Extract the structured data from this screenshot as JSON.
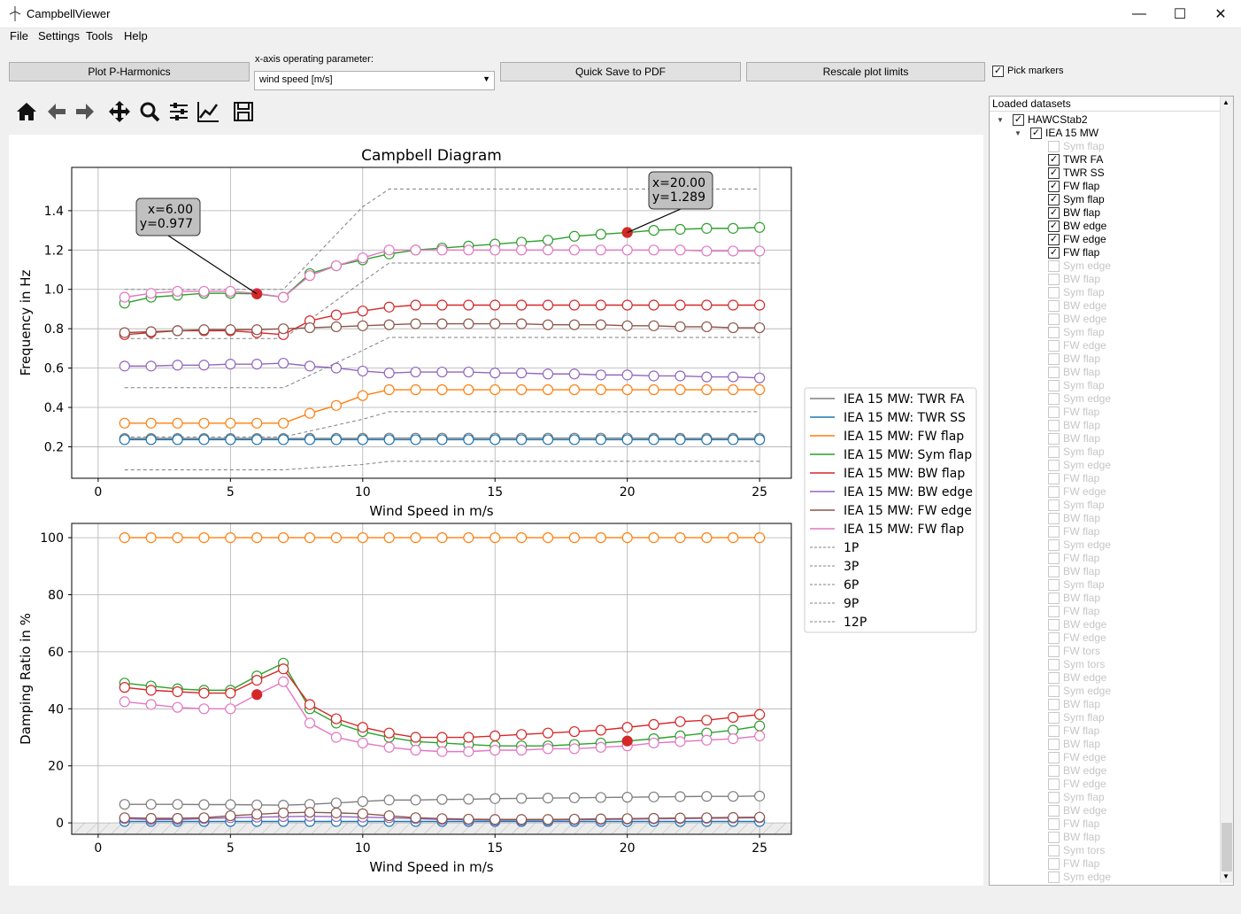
{
  "app": {
    "title": "CampbellViewer"
  },
  "menu": [
    "File",
    "Settings",
    "Tools",
    "Help"
  ],
  "controls": {
    "plot_p_harmonics": "Plot P-Harmonics",
    "x_axis_label": "x-axis operating parameter:",
    "x_axis_value": "wind speed [m/s]",
    "quick_save": "Quick Save to PDF",
    "rescale": "Rescale plot limits",
    "pick_markers": "Pick markers",
    "pick_markers_checked": true
  },
  "toolbar_icons": [
    "home-icon",
    "back-arrow-icon",
    "forward-arrow-icon",
    "pan-icon",
    "zoom-icon",
    "configure-subplots-icon",
    "edit-axis-icon",
    "save-icon"
  ],
  "tree": {
    "header": "Loaded datasets",
    "root": "HAWCStab2",
    "child": "IEA 15 MW",
    "modes": [
      {
        "name": "Sym flap",
        "on": false,
        "checked": false
      },
      {
        "name": "TWR FA",
        "on": true,
        "checked": true
      },
      {
        "name": "TWR SS",
        "on": true,
        "checked": true
      },
      {
        "name": "FW flap",
        "on": true,
        "checked": true
      },
      {
        "name": "Sym flap",
        "on": true,
        "checked": true
      },
      {
        "name": "BW flap",
        "on": true,
        "checked": true
      },
      {
        "name": "BW edge",
        "on": true,
        "checked": true
      },
      {
        "name": "FW edge",
        "on": true,
        "checked": true
      },
      {
        "name": "FW flap",
        "on": true,
        "checked": true
      },
      {
        "name": "Sym edge",
        "on": false,
        "checked": false
      },
      {
        "name": "BW flap",
        "on": false,
        "checked": false
      },
      {
        "name": "Sym flap",
        "on": false,
        "checked": false
      },
      {
        "name": "BW edge",
        "on": false,
        "checked": false
      },
      {
        "name": "BW edge",
        "on": false,
        "checked": false
      },
      {
        "name": "Sym flap",
        "on": false,
        "checked": false
      },
      {
        "name": "FW edge",
        "on": false,
        "checked": false
      },
      {
        "name": "BW flap",
        "on": false,
        "checked": false
      },
      {
        "name": "BW flap",
        "on": false,
        "checked": false
      },
      {
        "name": "Sym flap",
        "on": false,
        "checked": false
      },
      {
        "name": "Sym edge",
        "on": false,
        "checked": false
      },
      {
        "name": "FW flap",
        "on": false,
        "checked": false
      },
      {
        "name": "BW flap",
        "on": false,
        "checked": false
      },
      {
        "name": "BW flap",
        "on": false,
        "checked": false
      },
      {
        "name": "Sym flap",
        "on": false,
        "checked": false
      },
      {
        "name": "Sym edge",
        "on": false,
        "checked": false
      },
      {
        "name": "FW flap",
        "on": false,
        "checked": false
      },
      {
        "name": "FW edge",
        "on": false,
        "checked": false
      },
      {
        "name": "Sym flap",
        "on": false,
        "checked": false
      },
      {
        "name": "BW flap",
        "on": false,
        "checked": false
      },
      {
        "name": "FW flap",
        "on": false,
        "checked": false
      },
      {
        "name": "Sym edge",
        "on": false,
        "checked": false
      },
      {
        "name": "FW flap",
        "on": false,
        "checked": false
      },
      {
        "name": "BW flap",
        "on": false,
        "checked": false
      },
      {
        "name": "Sym flap",
        "on": false,
        "checked": false
      },
      {
        "name": "BW flap",
        "on": false,
        "checked": false
      },
      {
        "name": "FW flap",
        "on": false,
        "checked": false
      },
      {
        "name": "BW edge",
        "on": false,
        "checked": false
      },
      {
        "name": "FW edge",
        "on": false,
        "checked": false
      },
      {
        "name": "FW tors",
        "on": false,
        "checked": false
      },
      {
        "name": "Sym tors",
        "on": false,
        "checked": false
      },
      {
        "name": "BW edge",
        "on": false,
        "checked": false
      },
      {
        "name": "Sym edge",
        "on": false,
        "checked": false
      },
      {
        "name": "BW flap",
        "on": false,
        "checked": false
      },
      {
        "name": "Sym flap",
        "on": false,
        "checked": false
      },
      {
        "name": "FW flap",
        "on": false,
        "checked": false
      },
      {
        "name": "BW flap",
        "on": false,
        "checked": false
      },
      {
        "name": "FW edge",
        "on": false,
        "checked": false
      },
      {
        "name": "BW edge",
        "on": false,
        "checked": false
      },
      {
        "name": "FW edge",
        "on": false,
        "checked": false
      },
      {
        "name": "Sym flap",
        "on": false,
        "checked": false
      },
      {
        "name": "BW edge",
        "on": false,
        "checked": false
      },
      {
        "name": "FW flap",
        "on": false,
        "checked": false
      },
      {
        "name": "BW flap",
        "on": false,
        "checked": false
      },
      {
        "name": "Sym tors",
        "on": false,
        "checked": false
      },
      {
        "name": "FW flap",
        "on": false,
        "checked": false
      },
      {
        "name": "Sym edge",
        "on": false,
        "checked": false
      }
    ]
  },
  "chart_data": [
    {
      "type": "line",
      "title": "Campbell Diagram",
      "xlabel": "Wind Speed in m/s",
      "ylabel": "Frequency in Hz",
      "xlim": [
        -1,
        26.2
      ],
      "ylim": [
        0.04,
        1.62
      ],
      "xticks": [
        0,
        5,
        10,
        15,
        20,
        25
      ],
      "yticks": [
        0.2,
        0.4,
        0.6,
        0.8,
        1.0,
        1.2,
        1.4
      ],
      "x": [
        1,
        2,
        3,
        4,
        5,
        6,
        7,
        8,
        9,
        10,
        11,
        12,
        13,
        14,
        15,
        16,
        17,
        18,
        19,
        20,
        21,
        22,
        23,
        24,
        25
      ],
      "series": [
        {
          "name": "IEA 15 MW: TWR FA",
          "color": "#7f7f7f",
          "values": [
            0.242,
            0.242,
            0.242,
            0.242,
            0.242,
            0.242,
            0.242,
            0.243,
            0.243,
            0.243,
            0.244,
            0.244,
            0.244,
            0.244,
            0.244,
            0.244,
            0.244,
            0.244,
            0.244,
            0.244,
            0.243,
            0.243,
            0.243,
            0.243,
            0.243
          ]
        },
        {
          "name": "IEA 15 MW: TWR SS",
          "color": "#1f77b4",
          "values": [
            0.236,
            0.236,
            0.236,
            0.236,
            0.236,
            0.236,
            0.236,
            0.236,
            0.236,
            0.236,
            0.236,
            0.236,
            0.236,
            0.236,
            0.236,
            0.236,
            0.236,
            0.236,
            0.236,
            0.236,
            0.236,
            0.236,
            0.236,
            0.236,
            0.236
          ]
        },
        {
          "name": "IEA 15 MW: FW flap",
          "color": "#ff7f0e",
          "values": [
            0.32,
            0.32,
            0.32,
            0.32,
            0.32,
            0.32,
            0.32,
            0.37,
            0.41,
            0.46,
            0.49,
            0.49,
            0.49,
            0.49,
            0.49,
            0.49,
            0.49,
            0.49,
            0.49,
            0.49,
            0.49,
            0.49,
            0.49,
            0.49,
            0.49
          ]
        },
        {
          "name": "IEA 15 MW: Sym flap",
          "color": "#2ca02c",
          "values": [
            0.93,
            0.96,
            0.97,
            0.98,
            0.98,
            0.977,
            0.96,
            1.08,
            1.12,
            1.15,
            1.18,
            1.2,
            1.21,
            1.22,
            1.23,
            1.24,
            1.25,
            1.27,
            1.28,
            1.289,
            1.3,
            1.305,
            1.31,
            1.31,
            1.315
          ]
        },
        {
          "name": "IEA 15 MW: BW flap",
          "color": "#d62728",
          "values": [
            0.77,
            0.78,
            0.79,
            0.79,
            0.79,
            0.78,
            0.77,
            0.84,
            0.87,
            0.89,
            0.91,
            0.92,
            0.92,
            0.92,
            0.92,
            0.92,
            0.92,
            0.92,
            0.92,
            0.92,
            0.92,
            0.92,
            0.92,
            0.92,
            0.92
          ]
        },
        {
          "name": "IEA 15 MW: BW edge",
          "color": "#9467bd",
          "values": [
            0.61,
            0.61,
            0.615,
            0.615,
            0.62,
            0.62,
            0.625,
            0.61,
            0.6,
            0.585,
            0.575,
            0.58,
            0.58,
            0.58,
            0.575,
            0.575,
            0.57,
            0.57,
            0.565,
            0.565,
            0.56,
            0.56,
            0.555,
            0.555,
            0.55
          ]
        },
        {
          "name": "IEA 15 MW: FW edge",
          "color": "#8c564b",
          "values": [
            0.78,
            0.785,
            0.79,
            0.795,
            0.795,
            0.795,
            0.8,
            0.805,
            0.81,
            0.815,
            0.82,
            0.825,
            0.825,
            0.825,
            0.825,
            0.825,
            0.82,
            0.82,
            0.82,
            0.815,
            0.815,
            0.81,
            0.81,
            0.805,
            0.805
          ]
        },
        {
          "name": "IEA 15 MW: FW flap",
          "color": "#e377c2",
          "values": [
            0.96,
            0.98,
            0.99,
            0.99,
            0.99,
            0.98,
            0.96,
            1.07,
            1.12,
            1.16,
            1.2,
            1.2,
            1.2,
            1.2,
            1.2,
            1.2,
            1.2,
            1.2,
            1.2,
            1.2,
            1.2,
            1.2,
            1.195,
            1.195,
            1.195
          ]
        }
      ],
      "harmonics": [
        {
          "name": "1P",
          "x": [
            1,
            7,
            10,
            11,
            25
          ],
          "values": [
            0.083,
            0.083,
            0.11,
            0.126,
            0.126
          ]
        },
        {
          "name": "3P",
          "x": [
            1,
            7,
            10,
            11,
            25
          ],
          "values": [
            0.25,
            0.25,
            0.34,
            0.378,
            0.378
          ]
        },
        {
          "name": "6P",
          "x": [
            1,
            7,
            10,
            11,
            25
          ],
          "values": [
            0.5,
            0.5,
            0.69,
            0.756,
            0.756
          ]
        },
        {
          "name": "9P",
          "x": [
            1,
            7,
            10,
            11,
            25
          ],
          "values": [
            0.75,
            0.75,
            1.04,
            1.134,
            1.134
          ]
        },
        {
          "name": "12P",
          "x": [
            1,
            7,
            10,
            11,
            25
          ],
          "values": [
            1.0,
            1.0,
            1.42,
            1.51,
            1.51
          ]
        }
      ],
      "annotations": [
        {
          "text": "x=6.00\ny=0.977",
          "x": 6,
          "y": 0.977
        },
        {
          "text": "x=20.00\ny=1.289",
          "x": 20,
          "y": 1.289
        }
      ]
    },
    {
      "type": "line",
      "title": "",
      "xlabel": "Wind Speed in m/s",
      "ylabel": "Damping Ratio in %",
      "xlim": [
        -1,
        26.2
      ],
      "ylim": [
        -4,
        105
      ],
      "xticks": [
        0,
        5,
        10,
        15,
        20,
        25
      ],
      "yticks": [
        0,
        20,
        40,
        60,
        80,
        100
      ],
      "x": [
        1,
        2,
        3,
        4,
        5,
        6,
        7,
        8,
        9,
        10,
        11,
        12,
        13,
        14,
        15,
        16,
        17,
        18,
        19,
        20,
        21,
        22,
        23,
        24,
        25
      ],
      "series": [
        {
          "name": "TWR FA",
          "color": "#7f7f7f",
          "values": [
            6.5,
            6.5,
            6.5,
            6.4,
            6.4,
            6.3,
            6.2,
            6.5,
            7,
            7.5,
            8,
            8,
            8.2,
            8.3,
            8.5,
            8.6,
            8.7,
            8.8,
            8.9,
            9,
            9.1,
            9.2,
            9.3,
            9.3,
            9.4
          ]
        },
        {
          "name": "TWR SS",
          "color": "#1f77b4",
          "values": [
            0.5,
            0.5,
            0.5,
            0.5,
            0.5,
            0.5,
            0.5,
            0.5,
            0.5,
            0.5,
            0.5,
            0.5,
            0.5,
            0.5,
            0.5,
            0.5,
            0.5,
            0.5,
            0.5,
            0.5,
            0.5,
            0.5,
            0.5,
            0.5,
            0.5
          ]
        },
        {
          "name": "FW flap",
          "color": "#ff7f0e",
          "values": [
            100,
            100,
            100,
            100,
            100,
            100,
            100,
            100,
            100,
            100,
            100,
            100,
            100,
            100,
            100,
            100,
            100,
            100,
            100,
            100,
            100,
            100,
            100,
            100,
            100
          ]
        },
        {
          "name": "Sym flap",
          "color": "#2ca02c",
          "values": [
            49,
            48,
            47,
            46.5,
            46.5,
            51.5,
            56,
            40,
            35,
            32,
            30,
            28.5,
            28,
            27.5,
            27,
            27,
            27,
            27.5,
            28,
            28.7,
            29.5,
            30.5,
            31.5,
            32.5,
            34
          ]
        },
        {
          "name": "BW flap",
          "color": "#d62728",
          "values": [
            47.5,
            46.5,
            46,
            45.5,
            45.5,
            50,
            54,
            41.5,
            36.5,
            33.5,
            31.5,
            30,
            30,
            30,
            30.5,
            31,
            31.5,
            32,
            32.5,
            33.5,
            34.5,
            35.5,
            36,
            37,
            38
          ]
        },
        {
          "name": "BW edge",
          "color": "#9467bd",
          "values": [
            1.5,
            1.2,
            1.2,
            1.5,
            1.8,
            2,
            2.2,
            2.3,
            2.2,
            2,
            1.8,
            1.5,
            1.2,
            1.1,
            1,
            1,
            1,
            1.1,
            1.2,
            1.3,
            1.4,
            1.5,
            1.6,
            1.7,
            1.8
          ]
        },
        {
          "name": "FW edge",
          "color": "#8c564b",
          "values": [
            1.8,
            1.6,
            1.6,
            1.8,
            2.5,
            3,
            3.5,
            3.7,
            3.5,
            3.2,
            2.5,
            1.8,
            1.5,
            1.3,
            1.2,
            1.2,
            1.2,
            1.3,
            1.4,
            1.5,
            1.6,
            1.7,
            1.8,
            1.9,
            2
          ]
        },
        {
          "name": "FW flap",
          "color": "#e377c2",
          "values": [
            42.5,
            41.5,
            40.5,
            40,
            40,
            45,
            49.5,
            35,
            30,
            28,
            26.5,
            25.5,
            25,
            25,
            25.5,
            25.5,
            26,
            26,
            26.5,
            27,
            28,
            28.5,
            29,
            29.5,
            30.5
          ]
        }
      ],
      "picked": [
        {
          "x": 6,
          "y": 45
        },
        {
          "x": 20,
          "y": 28.7
        }
      ]
    }
  ],
  "legend": [
    "IEA 15 MW: TWR FA",
    "IEA 15 MW: TWR SS",
    "IEA 15 MW: FW flap",
    "IEA 15 MW: Sym flap",
    "IEA 15 MW: BW flap",
    "IEA 15 MW: BW edge",
    "IEA 15 MW: FW edge",
    "IEA 15 MW: FW flap",
    "1P",
    "3P",
    "6P",
    "9P",
    "12P"
  ],
  "colors": {
    "picked": "#d62728",
    "harmonic": "#808080"
  }
}
